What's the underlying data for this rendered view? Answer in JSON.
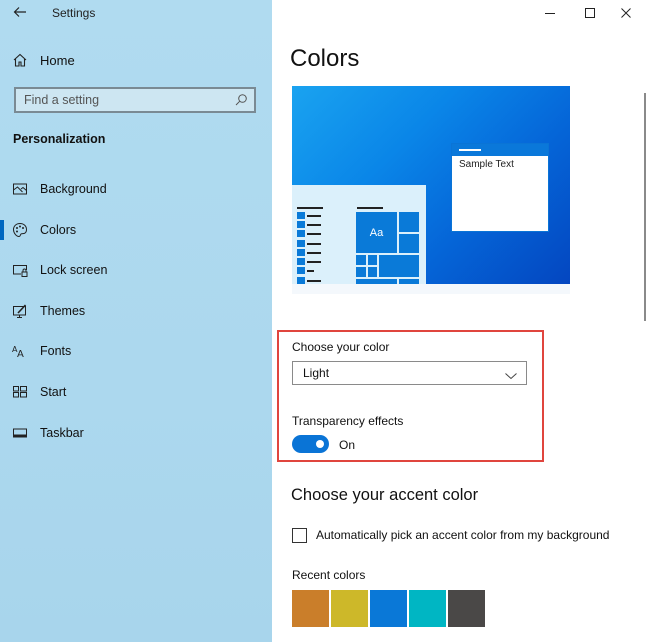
{
  "window": {
    "title": "Settings",
    "controls": {
      "minimize": "minimize",
      "maximize": "maximize",
      "close": "close"
    }
  },
  "sidebar": {
    "home_label": "Home",
    "search_placeholder": "Find a setting",
    "section_title": "Personalization",
    "items": [
      {
        "label": "Background",
        "icon": "picture-icon"
      },
      {
        "label": "Colors",
        "icon": "palette-icon",
        "selected": true
      },
      {
        "label": "Lock screen",
        "icon": "lock-screen-icon"
      },
      {
        "label": "Themes",
        "icon": "themes-icon"
      },
      {
        "label": "Fonts",
        "icon": "fonts-icon"
      },
      {
        "label": "Start",
        "icon": "start-icon"
      },
      {
        "label": "Taskbar",
        "icon": "taskbar-icon"
      }
    ],
    "accent": "#0067c0"
  },
  "main": {
    "page_title": "Colors",
    "preview": {
      "sample_text": "Sample Text",
      "tile_text": "Aa"
    },
    "choose_color": {
      "label": "Choose your color",
      "selected": "Light"
    },
    "transparency": {
      "label": "Transparency effects",
      "state": "On",
      "enabled": true
    },
    "accent_section": {
      "heading": "Choose your accent color",
      "auto_pick_label": "Automatically pick an accent color from my background",
      "auto_pick_checked": false,
      "recent_label": "Recent colors",
      "recent_colors": [
        "#ca7e2a",
        "#cdb829",
        "#0a78d7",
        "#00b6c3",
        "#4a4847"
      ]
    },
    "highlight_color": "#e0453e"
  }
}
